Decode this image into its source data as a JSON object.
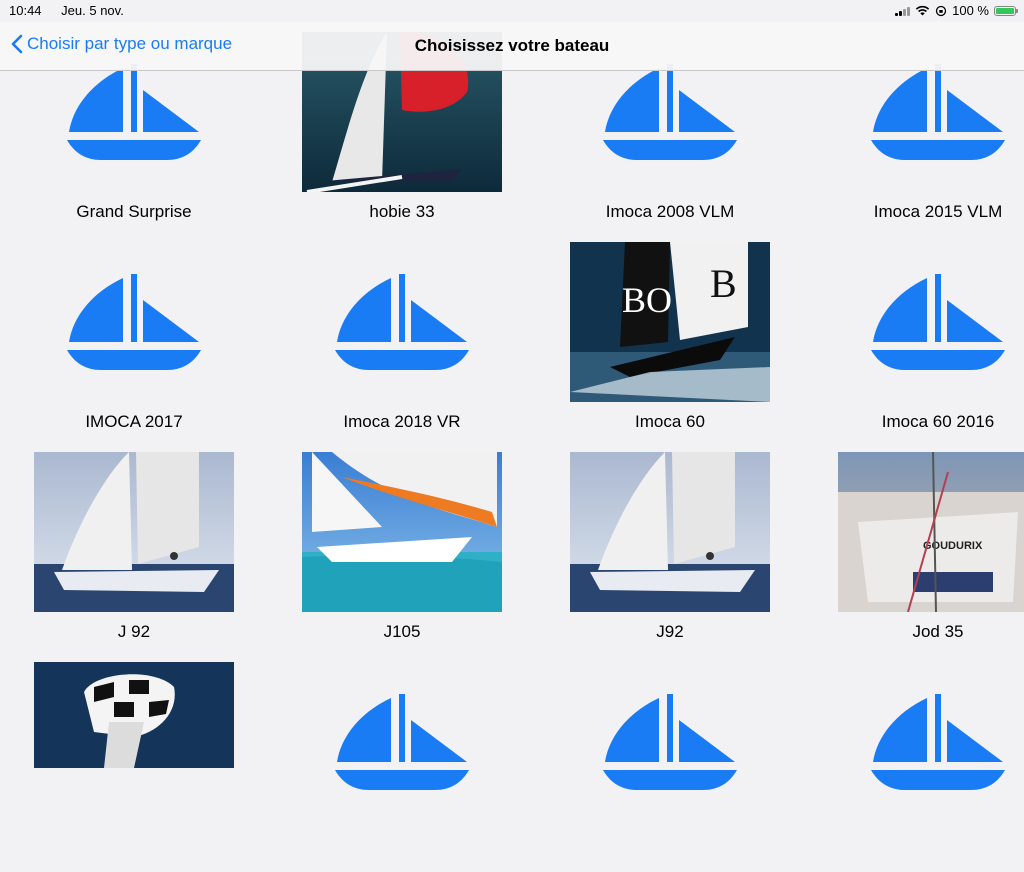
{
  "status": {
    "time": "10:44",
    "date": "Jeu. 5 nov.",
    "battery": "100 %",
    "battery_level": 1.0
  },
  "nav": {
    "back_label": "Choisir par type ou marque",
    "title": "Choisissez votre bateau"
  },
  "colors": {
    "accent": "#1a7cf5",
    "sailboat_icon": "#1a7cf5"
  },
  "boats": [
    {
      "name": "Grand Surprise",
      "image": "sailboat-icon"
    },
    {
      "name": "hobie 33",
      "image": "photo-red-spinnaker"
    },
    {
      "name": "Imoca 2008 VLM",
      "image": "sailboat-icon"
    },
    {
      "name": "Imoca 2015 VLM",
      "image": "sailboat-icon"
    },
    {
      "name": "IMOCA 2017",
      "image": "sailboat-icon"
    },
    {
      "name": "Imoca 2018 VR",
      "image": "sailboat-icon"
    },
    {
      "name": "Imoca 60",
      "image": "photo-boss-imoca"
    },
    {
      "name": "Imoca 60 2016",
      "image": "sailboat-icon"
    },
    {
      "name": "J 92",
      "image": "photo-j92-sailing"
    },
    {
      "name": "J105",
      "image": "photo-j105-orange-sail"
    },
    {
      "name": "J92",
      "image": "photo-j92-sailing"
    },
    {
      "name": "Jod 35",
      "image": "photo-goudurix-moored"
    },
    {
      "name": "",
      "image": "photo-checkered-spinnaker"
    },
    {
      "name": "",
      "image": "sailboat-icon"
    },
    {
      "name": "",
      "image": "sailboat-icon"
    },
    {
      "name": "",
      "image": "sailboat-icon"
    }
  ]
}
